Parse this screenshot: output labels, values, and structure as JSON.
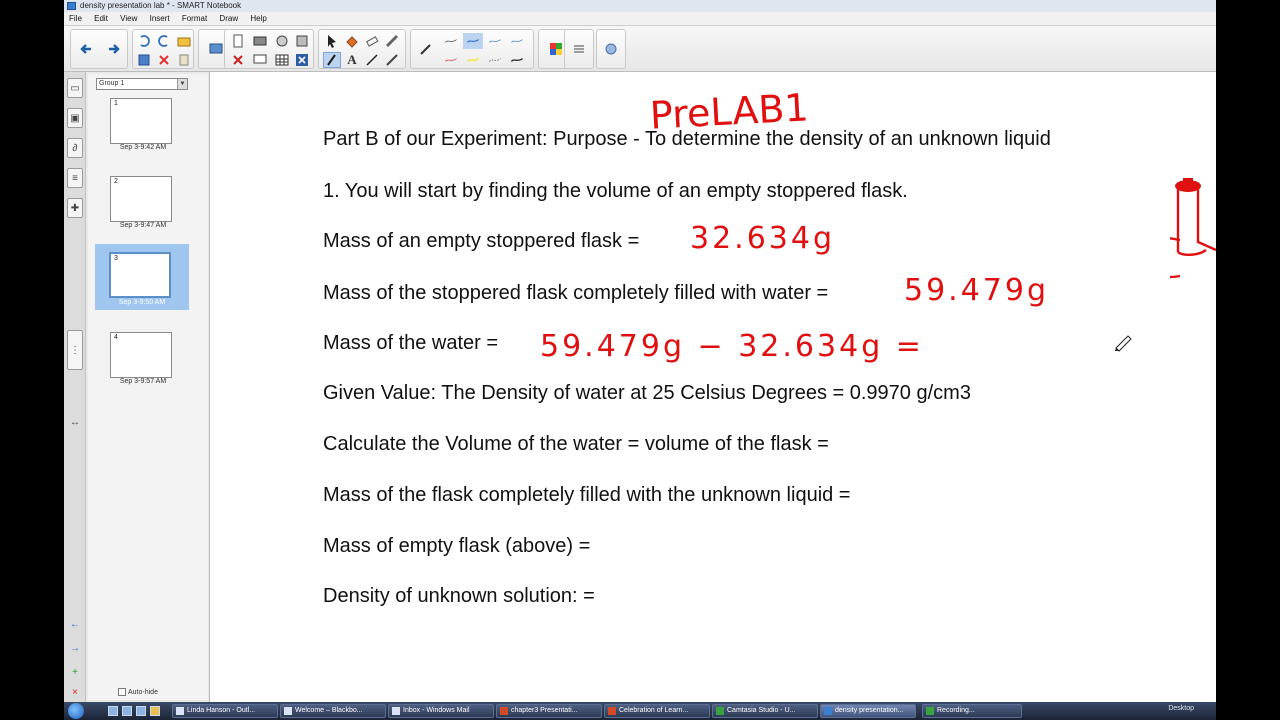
{
  "window": {
    "title": "density presentation lab * - SMART Notebook"
  },
  "menu": [
    "File",
    "Edit",
    "View",
    "Insert",
    "Format",
    "Draw",
    "Help"
  ],
  "toolbar": {
    "icons": [
      "back-icon",
      "forward-icon",
      "undo-icon",
      "redo-icon",
      "open-icon",
      "save-icon",
      "screen-shade-icon",
      "paste-icon",
      "screen-capture-icon",
      "table-icon",
      "delete-icon",
      "select-icon",
      "pen-icon",
      "eraser-icon",
      "fill-icon",
      "shape-icon",
      "text-icon",
      "line-icon",
      "magic-pen-icon",
      "color-palette-icon",
      "properties-icon"
    ]
  },
  "sidepanel": {
    "group_label": "Group 1",
    "slides": [
      {
        "number": "1",
        "date": "Sep 3-9:42 AM"
      },
      {
        "number": "2",
        "date": "Sep 3-9:47 AM"
      },
      {
        "number": "3",
        "date": "Sep 3-9:50 AM"
      },
      {
        "number": "4",
        "date": "Sep 3-9:57 AM"
      }
    ],
    "auto_hide": "Auto-hide"
  },
  "page": {
    "handwritten_title": "PreLAB1",
    "lines": [
      "Part B of our Experiment:  Purpose - To determine the density of an unknown liquid",
      "1.  You will start by finding the volume of an empty stoppered flask.",
      "Mass of an empty stoppered flask = ",
      "Mass of the stoppered flask completely filled with water = ",
      "Mass of the water = ",
      "Given Value:  The Density of water at 25 Celsius Degrees = 0.9970 g/cm3",
      "Calculate the Volume of the water = volume of the flask = ",
      "Mass of the flask completely filled with the unknown liquid = ",
      "Mass of empty flask (above) = ",
      "Density of unknown solution:  = "
    ],
    "ink": {
      "empty_flask_mass": "32.634g",
      "filled_flask_mass": "59.479g",
      "water_mass_expr": "59.479g − 32.634g ="
    },
    "ink_color": "#e01010"
  },
  "taskbar": {
    "tasks": [
      "Linda Hanson - Outl...",
      "Welcome – Blackbo...",
      "Inbox - Windows Mail",
      "chapter3 Presentati...",
      "Celebration of Learn...",
      "Camtasia Studio - U...",
      "density presentation...",
      "Recording..."
    ],
    "desktop": "Desktop"
  }
}
